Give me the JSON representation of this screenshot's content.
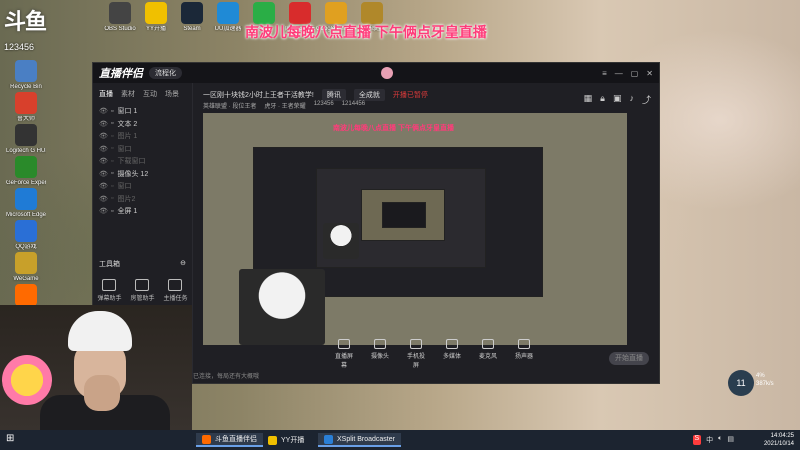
{
  "overlay": {
    "logo": "斗鱼",
    "room_id": "123456",
    "banner": "南波儿每晚八点直播 下午俩点牙皇直播"
  },
  "desktop_icons": [
    {
      "label": "Recycle Bin",
      "color": "#4a7fc4"
    },
    {
      "label": "鲁大师",
      "color": "#d8402c"
    },
    {
      "label": "Logitech G HUB",
      "color": "#333"
    },
    {
      "label": "GeForce Experience",
      "color": "#2a8a2a"
    },
    {
      "label": "Microsoft Edge",
      "color": "#1f7bd6"
    },
    {
      "label": "QQ游戏",
      "color": "#2a6fd6"
    },
    {
      "label": "WeGame",
      "color": "#c8a02a"
    },
    {
      "label": "斗鱼",
      "color": "#ff6a00"
    },
    {
      "label": "OBS Studio",
      "color": "#444"
    },
    {
      "label": "YY开播",
      "color": "#f0c000"
    },
    {
      "label": "Steam",
      "color": "#1b2838"
    },
    {
      "label": "UU加速器",
      "color": "#1f8ad6"
    },
    {
      "label": "微信",
      "color": "#2aae46"
    },
    {
      "label": "网易云音乐",
      "color": "#d82c2c"
    },
    {
      "label": "Google Chrome",
      "color": "#e0a020"
    },
    {
      "label": "英雄联盟",
      "color": "#b0882a"
    }
  ],
  "app": {
    "brand": "直播伴侣",
    "brand_pill": "流程化",
    "title_info": "一区刚十块钱2小时上王者干活教学!",
    "category_chip": "腾讯",
    "mode_chip": "全成就",
    "status_red": "开播已暂停",
    "row2_a": "英雄联盟 · 段位王者",
    "row2_b": "虎牙 · 王者荣耀",
    "row2_id": "123456",
    "row2_num": "1214456",
    "side_tabs": [
      "直播",
      "素材",
      "互动",
      "场景"
    ],
    "scenes": [
      {
        "label": "窗口 1",
        "dim": false
      },
      {
        "label": "文本 2",
        "dim": false
      },
      {
        "label": "图片 1",
        "dim": true
      },
      {
        "label": "窗口",
        "dim": true
      },
      {
        "label": "下载窗口",
        "dim": true
      },
      {
        "label": "摄像头 12",
        "dim": false
      },
      {
        "label": "窗口",
        "dim": true
      },
      {
        "label": "图片2",
        "dim": true
      },
      {
        "label": "全屏 1",
        "dim": false
      }
    ],
    "tools_title": "工具箱",
    "tools": [
      "弹幕助手",
      "房管助手",
      "主播任务"
    ],
    "bottom_buttons": [
      "直播屏幕",
      "摄像头",
      "手机投屏",
      "多媒体",
      "麦克风",
      "扬声器"
    ],
    "live_button": "开始直播",
    "status_line": "已连接，每局还有大概哦"
  },
  "widget": {
    "gauge": "11",
    "lines": [
      "4%",
      "387k/s"
    ]
  },
  "taskbar": {
    "items": [
      {
        "label": "斗鱼直播伴侣",
        "color": "#ff6a00",
        "active": true
      },
      {
        "label": "YY开播",
        "color": "#f0c000",
        "active": false
      },
      {
        "label": "XSplit Broadcaster",
        "color": "#2a7fd6",
        "active": true
      }
    ],
    "ime": "S",
    "ime_text": "中",
    "time": "14:04:25",
    "date": "2021/10/14"
  }
}
